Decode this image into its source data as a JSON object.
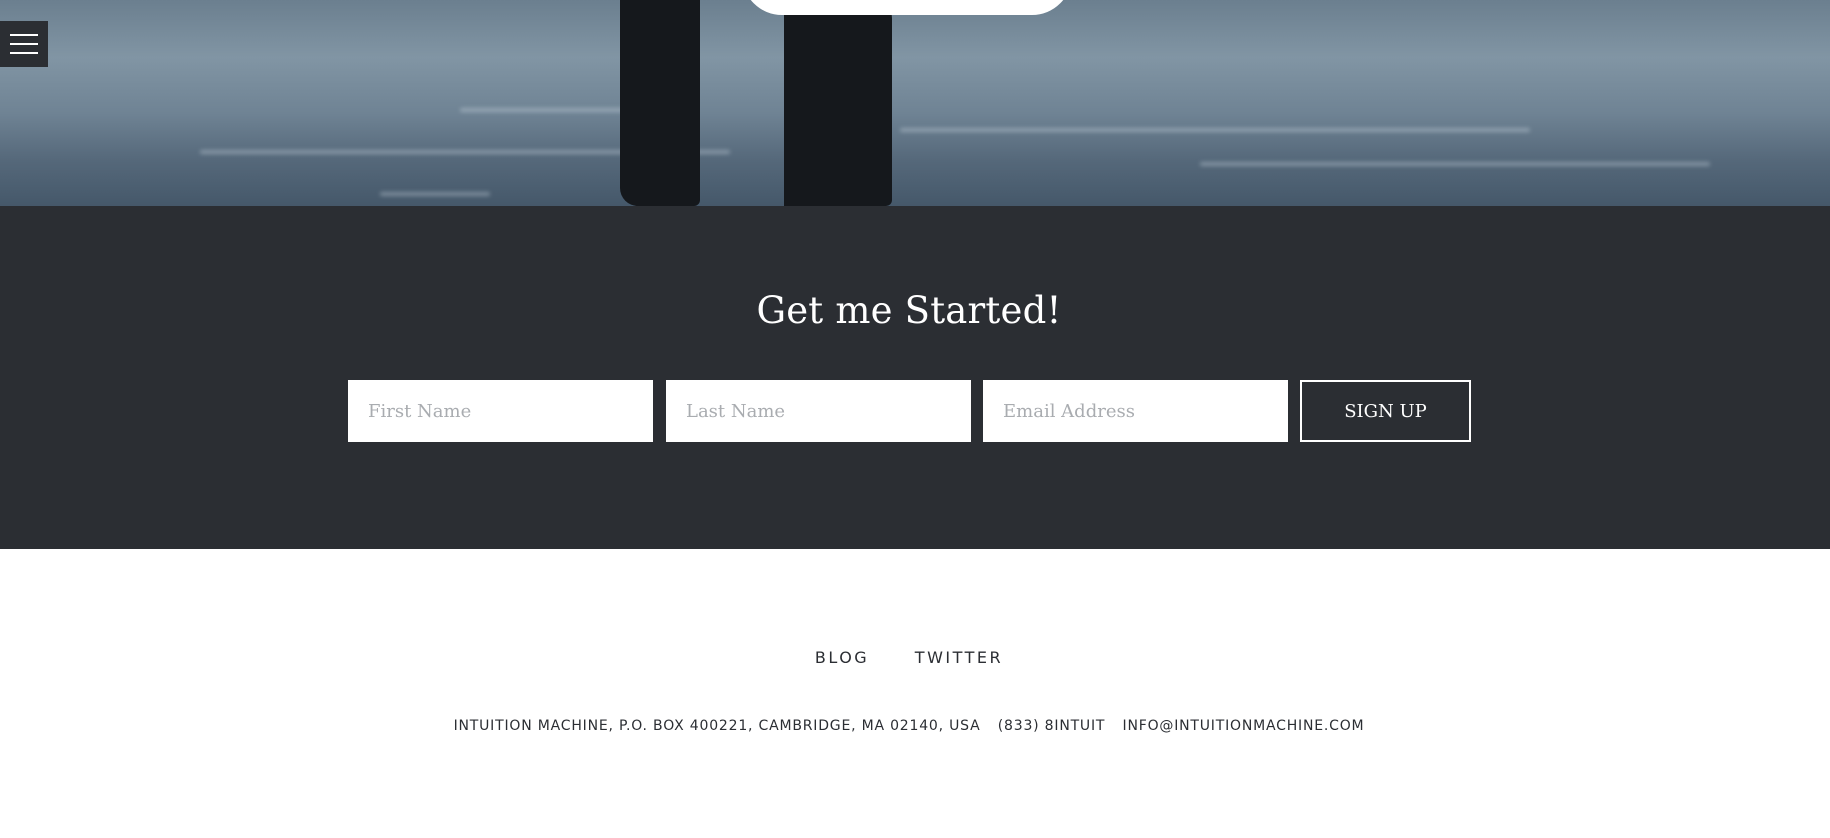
{
  "menu": {
    "icon": "hamburger-icon"
  },
  "signup": {
    "heading": "Get me Started!",
    "first_name_placeholder": "First Name",
    "last_name_placeholder": "Last Name",
    "email_placeholder": "Email Address",
    "submit_label": "SIGN UP"
  },
  "footer": {
    "links": [
      "BLOG",
      "TWITTER"
    ],
    "address": "INTUITION MACHINE, P.O. BOX 400221, CAMBRIDGE, MA 02140, USA",
    "phone": "(833) 8INTUIT",
    "email": "INFO@INTUITIONMACHINE.COM"
  },
  "colors": {
    "band_background": "#2b2e33",
    "text_dark": "#2b2e33",
    "white": "#ffffff"
  }
}
